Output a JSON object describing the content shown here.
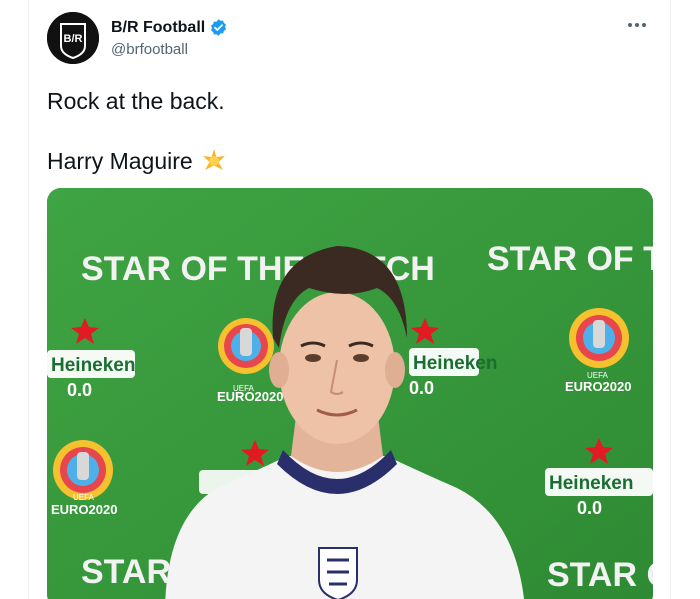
{
  "author": {
    "display_name": "B/R Football",
    "handle": "@brfootball",
    "avatar_text": "B/R",
    "verified": true
  },
  "tweet": {
    "line1": "Rock at the back.",
    "line2": "Harry Maguire",
    "emoji": "star"
  },
  "media": {
    "backdrop_text": "STAR OF THE MATCH",
    "sponsor": "Heineken",
    "sponsor_sub": "0.0",
    "event_label": "EURO2020",
    "uefa_label": "UEFA",
    "colors": {
      "backdrop_green": "#3a9a3e",
      "shirt": "#f4f4f4",
      "collar": "#2a2f6b"
    }
  },
  "colors": {
    "verified_blue": "#1d9bf0",
    "text": "#0f1419",
    "muted": "#536471"
  }
}
